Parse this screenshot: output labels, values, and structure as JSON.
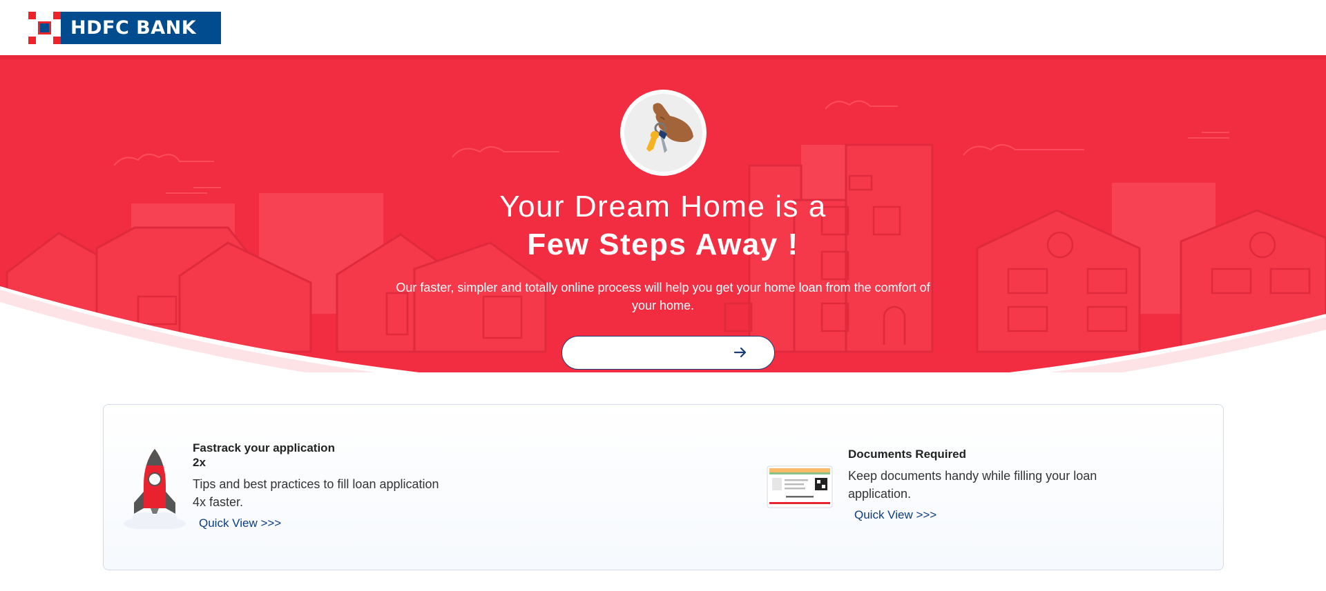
{
  "header": {
    "logo_text": "HDFC BANK"
  },
  "hero": {
    "title_line1": "Your Dream Home is a",
    "title_line2": "Few Steps Away !",
    "subtitle": "Our faster, simpler and totally online process will help you get your home loan from the comfort of your home.",
    "cta_label": "",
    "cta_icon": "arrow-right-icon",
    "badge_icon": "hand-with-keys-icon"
  },
  "cards": [
    {
      "title_line1": "Fastrack your application",
      "title_line2": "2x",
      "description": "Tips and best practices to fill loan application 4x faster.",
      "link_label": "Quick View >>>",
      "icon": "rocket-icon"
    },
    {
      "title": "Documents Required",
      "description": "Keep documents handy while filling your loan application.",
      "link_label": "Quick View >>>",
      "icon": "aadhaar-card-icon"
    }
  ],
  "colors": {
    "hero_red": "#f32d41",
    "brand_blue": "#004c8f",
    "brand_red": "#ed232a",
    "link_blue": "#0b3b80"
  }
}
